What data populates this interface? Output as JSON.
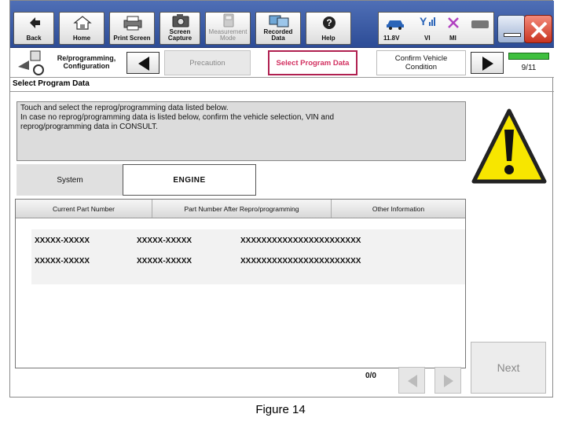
{
  "toolbar": {
    "back_label": "Back",
    "home_label": "Home",
    "print_label": "Print Screen",
    "capture_label_1": "Screen",
    "capture_label_2": "Capture",
    "measure_label_1": "Measurement",
    "measure_label_2": "Mode",
    "recorded_label_1": "Recorded",
    "recorded_label_2": "Data",
    "help_label": "Help"
  },
  "status": {
    "voltage": "11.8V",
    "vi": "VI",
    "mi": "MI"
  },
  "breadcrumb": {
    "app_line1": "Re/programming,",
    "app_line2": "Configuration",
    "step_precaution": "Precaution",
    "step_select": "Select Program Data",
    "step_confirm_1": "Confirm Vehicle",
    "step_confirm_2": "Condition",
    "page_count": "9/11"
  },
  "screen_title": "Select Program Data",
  "message": {
    "line1": "Touch and select the reprog/programming data listed below.",
    "line2": "In case no reprog/programming data is listed below, confirm the vehicle selection, VIN and",
    "line3": "reprog/programming data in CONSULT."
  },
  "system": {
    "label": "System",
    "value": "ENGINE"
  },
  "table": {
    "columns": [
      "Current Part Number",
      "Part Number After Repro/programming",
      "Other Information"
    ],
    "rows": [
      [
        "XXXXX-XXXXX",
        "XXXXX-XXXXX",
        "XXXXXXXXXXXXXXXXXXXXXXX"
      ],
      [
        "XXXXX-XXXXX",
        "XXXXX-XXXXX",
        "XXXXXXXXXXXXXXXXXXXXXXX"
      ]
    ]
  },
  "pager": {
    "count": "0/0"
  },
  "next_label": "Next",
  "caption": "Figure 14",
  "colors": {
    "toolbar_blue": "#3a5ba8",
    "active_step": "#d23060",
    "warning_yellow": "#f7e600",
    "progress_green": "#3fbf3f"
  }
}
